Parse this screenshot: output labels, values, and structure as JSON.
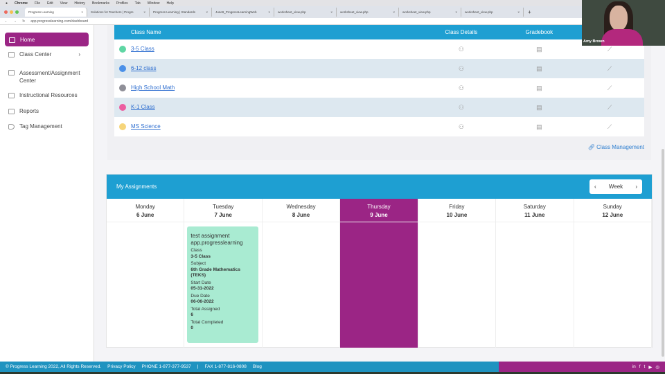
{
  "menubar": {
    "items": [
      "Chrome",
      "File",
      "Edit",
      "View",
      "History",
      "Bookmarks",
      "Profiles",
      "Tab",
      "Window",
      "Help"
    ]
  },
  "tabs": [
    "Progress Learning",
    "Solutions for Teachers | Progre",
    "Progress Learning | Standards",
    "June9_ProgressLearningWeb",
    "worksheet_view.php",
    "worksheet_view.php",
    "worksheet_view.php",
    "worksheet_view.php"
  ],
  "address": "app.progresslearning.com/dashboard",
  "sidebar": {
    "items": [
      {
        "label": "Home"
      },
      {
        "label": "Class Center"
      },
      {
        "label": "Assessment/Assignment Center"
      },
      {
        "label": "Instructional Resources"
      },
      {
        "label": "Reports"
      },
      {
        "label": "Tag Management"
      }
    ]
  },
  "classes": {
    "headers": [
      "Class Name",
      "Class Details",
      "Gradebook"
    ],
    "rows": [
      {
        "name": "3-5 Class",
        "color": "#5fd6a4"
      },
      {
        "name": "6-12 class",
        "color": "#4a90e8"
      },
      {
        "name": "High School Math",
        "color": "#8f8f98"
      },
      {
        "name": "K-1 Class",
        "color": "#ec5ea0"
      },
      {
        "name": "MS Science",
        "color": "#f6d57a"
      }
    ],
    "management_link": "Class Management"
  },
  "assignments": {
    "title": "My Assignments",
    "view": "Week",
    "days": [
      {
        "day": "Monday",
        "date": "6 June"
      },
      {
        "day": "Tuesday",
        "date": "7 June"
      },
      {
        "day": "Wednesday",
        "date": "8 June"
      },
      {
        "day": "Thursday",
        "date": "9 June"
      },
      {
        "day": "Friday",
        "date": "10 June"
      },
      {
        "day": "Saturday",
        "date": "11 June"
      },
      {
        "day": "Sunday",
        "date": "12 June"
      }
    ],
    "card": {
      "title": "test assignment app.progresslearning",
      "class_label": "Class",
      "class": "3-5 Class",
      "subject_label": "Subject",
      "subject": "6th Grade Mathematics (TEKS)",
      "start_label": "Start Date",
      "start": "05-31-2022",
      "due_label": "Due Date",
      "due": "06-06-2022",
      "assigned_label": "Total Assigned",
      "assigned": "6",
      "completed_label": "Total Completed",
      "completed": "0"
    }
  },
  "footer": {
    "copyright": "© Progress Learning 2022, All Rights Reserved.",
    "privacy": "Privacy Policy",
    "phone": "PHONE 1-877-377-9537",
    "sep": "|",
    "fax": "FAX 1-877-816-0808",
    "blog": "Blog"
  },
  "video": {
    "name": "Amy Brown"
  },
  "colors": {
    "brand_blue": "#1e9fd2",
    "brand_purple": "#9b2585",
    "card_green": "#a9ebd2"
  }
}
